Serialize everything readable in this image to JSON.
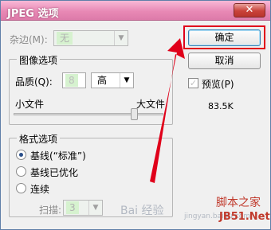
{
  "window": {
    "title": "JPEG 选项",
    "close_glyph": "✕"
  },
  "matte": {
    "label": "杂边(M):",
    "value": "无"
  },
  "image_options": {
    "group_title": "图像选项",
    "quality_label": "品质(Q):",
    "quality_value": "8",
    "quality_level": "高",
    "small_file_label": "小文件",
    "large_file_label": "大文件",
    "slider_level": 0.8
  },
  "format_options": {
    "group_title": "格式选项",
    "options": [
      {
        "label": "基线(“标准”)",
        "checked": true
      },
      {
        "label": "基线已优化",
        "checked": false
      },
      {
        "label": "连续",
        "checked": false
      }
    ],
    "scan_label": "扫描:",
    "scan_value": "3"
  },
  "buttons": {
    "ok": "确定",
    "cancel": "取消"
  },
  "preview": {
    "label": "预览(P)",
    "checked": true,
    "size": "83.5K"
  },
  "watermark": {
    "line1": "Bai 经验",
    "line2": "jingyan.baidu.com",
    "site1": "脚本之家",
    "site2": "JB51.Net"
  },
  "colors": {
    "annotation_red": "#e0001a",
    "titlebar_pink": "#e889b5"
  }
}
